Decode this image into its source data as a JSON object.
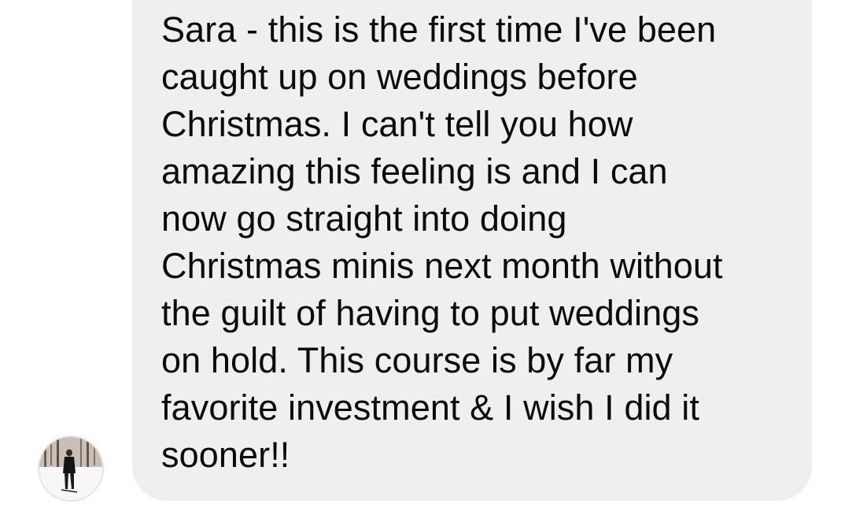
{
  "conversation": {
    "message": {
      "text": "Sara - this is the first time I've been\ncaught up on weddings before\nChristmas. I can't tell you how\namazing this feeling is and I can\nnow go straight into doing\nChristmas minis next month without\nthe guilt of having to put weddings\non hold. This course is by far my\nfavorite investment & I wish I did it\nsooner!!"
    },
    "avatar": {
      "icon": "sender-avatar-photo"
    }
  },
  "colors": {
    "bubble": "#efeff0",
    "text": "#0b0b0b",
    "background": "#ffffff"
  }
}
